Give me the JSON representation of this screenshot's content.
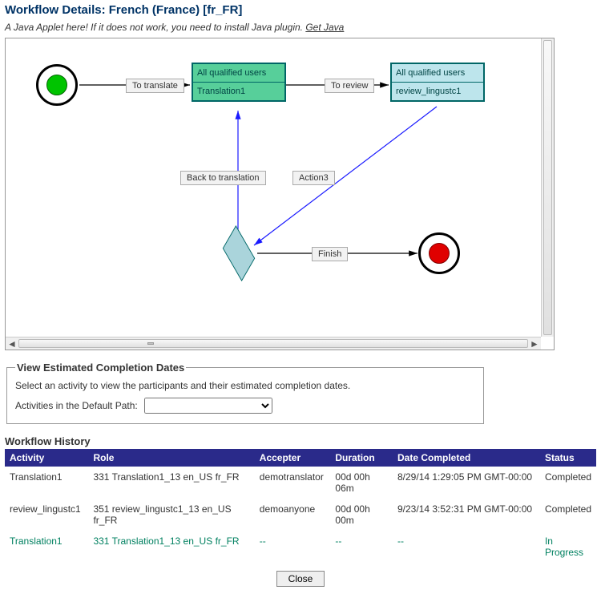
{
  "title": "Workflow Details: French (France) [fr_FR]",
  "applet_note": "A Java Applet here! If it does not work, you need to install Java plugin. ",
  "get_java": "Get Java",
  "diagram": {
    "start": "start",
    "end": "end",
    "task_translate": {
      "line1": "All qualified users",
      "line2": "Translation1"
    },
    "task_review": {
      "line1": "All qualified users",
      "line2": "review_lingustc1"
    },
    "edge_to_translate": "To translate",
    "edge_to_review": "To review",
    "edge_back": "Back to translation",
    "edge_action3": "Action3",
    "edge_finish": "Finish"
  },
  "completion": {
    "legend": "View Estimated Completion Dates",
    "text": "Select an activity to view the participants and their estimated completion dates.",
    "label": "Activities in the Default Path:",
    "selected": ""
  },
  "history_title": "Workflow History",
  "history_headers": {
    "activity": "Activity",
    "role": "Role",
    "accepter": "Accepter",
    "duration": "Duration",
    "date_completed": "Date Completed",
    "status": "Status"
  },
  "history_rows": [
    {
      "activity": "Translation1",
      "role": "331 Translation1_13 en_US fr_FR",
      "accepter": "demotranslator",
      "duration": "00d 00h 06m",
      "date_completed": "8/29/14 1:29:05 PM GMT-00:00",
      "status": "Completed"
    },
    {
      "activity": "review_lingustc1",
      "role": "351 review_lingustc1_13 en_US fr_FR",
      "accepter": "demoanyone",
      "duration": "00d 00h 00m",
      "date_completed": "9/23/14 3:52:31 PM GMT-00:00",
      "status": "Completed"
    },
    {
      "activity": "Translation1",
      "role": "331 Translation1_13 en_US fr_FR",
      "accepter": "--",
      "duration": "--",
      "date_completed": "--",
      "status": "In Progress"
    }
  ],
  "close_label": "Close"
}
